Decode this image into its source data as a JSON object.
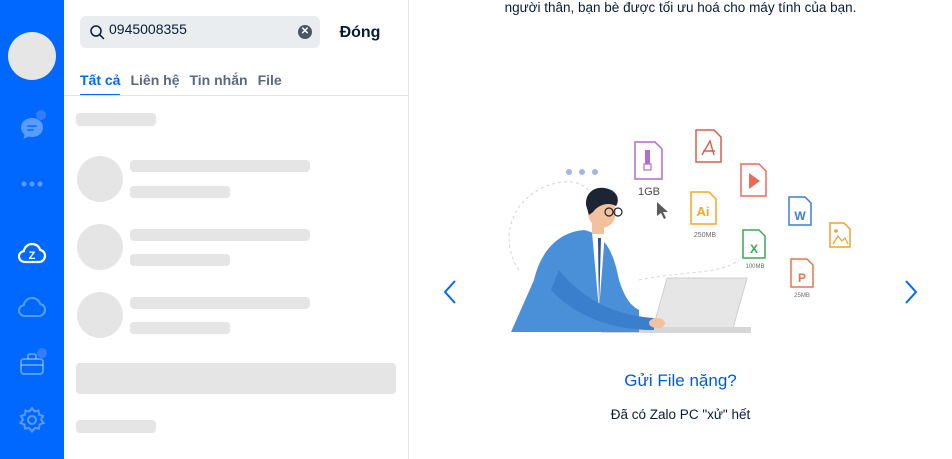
{
  "nav": {
    "items": [
      {
        "icon": "chat-icon"
      },
      {
        "icon": "more-dots-icon"
      },
      {
        "icon": "zalo-cloud-icon"
      },
      {
        "icon": "cloud-icon"
      },
      {
        "icon": "briefcase-icon"
      },
      {
        "icon": "settings-icon"
      }
    ]
  },
  "search": {
    "value": "0945008355",
    "close_label": "Đóng",
    "tabs": [
      "Tất cả",
      "Liên hệ",
      "Tin nhắn",
      "File"
    ]
  },
  "main": {
    "top_text": "người thân, bạn bè được tối ưu hoá cho máy tính của bạn.",
    "slide_title": "Gửi File nặng?",
    "slide_desc": "Đã có Zalo PC \"xử\" hết",
    "file_labels": {
      "zip_size": "1GB",
      "ai_size": "250MB",
      "excel_size": "100MB",
      "ppt_size": "25MB"
    },
    "accent": "#0068ff"
  }
}
